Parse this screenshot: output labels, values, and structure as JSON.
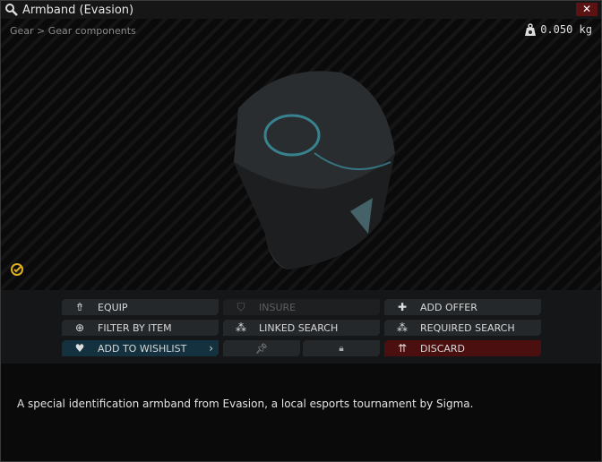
{
  "window": {
    "title": "Armband (Evasion)",
    "close_icon": "close-icon"
  },
  "view": {
    "breadcrumb": "Gear > Gear components",
    "weight": "0.050 kg"
  },
  "actions": {
    "equip": "EQUIP",
    "insure": "INSURE",
    "add_offer": "ADD OFFER",
    "filter_by_item": "FILTER BY ITEM",
    "linked_search": "LINKED SEARCH",
    "required_search": "REQUIRED SEARCH",
    "add_to_wishlist": "ADD TO WISHLIST",
    "discard": "DISCARD"
  },
  "description": "A special identification armband from Evasion, a local esports tournament by Sigma.",
  "colors": {
    "wishlist": "#13313f",
    "discard": "#4c0f0f",
    "close": "#5a1212"
  }
}
